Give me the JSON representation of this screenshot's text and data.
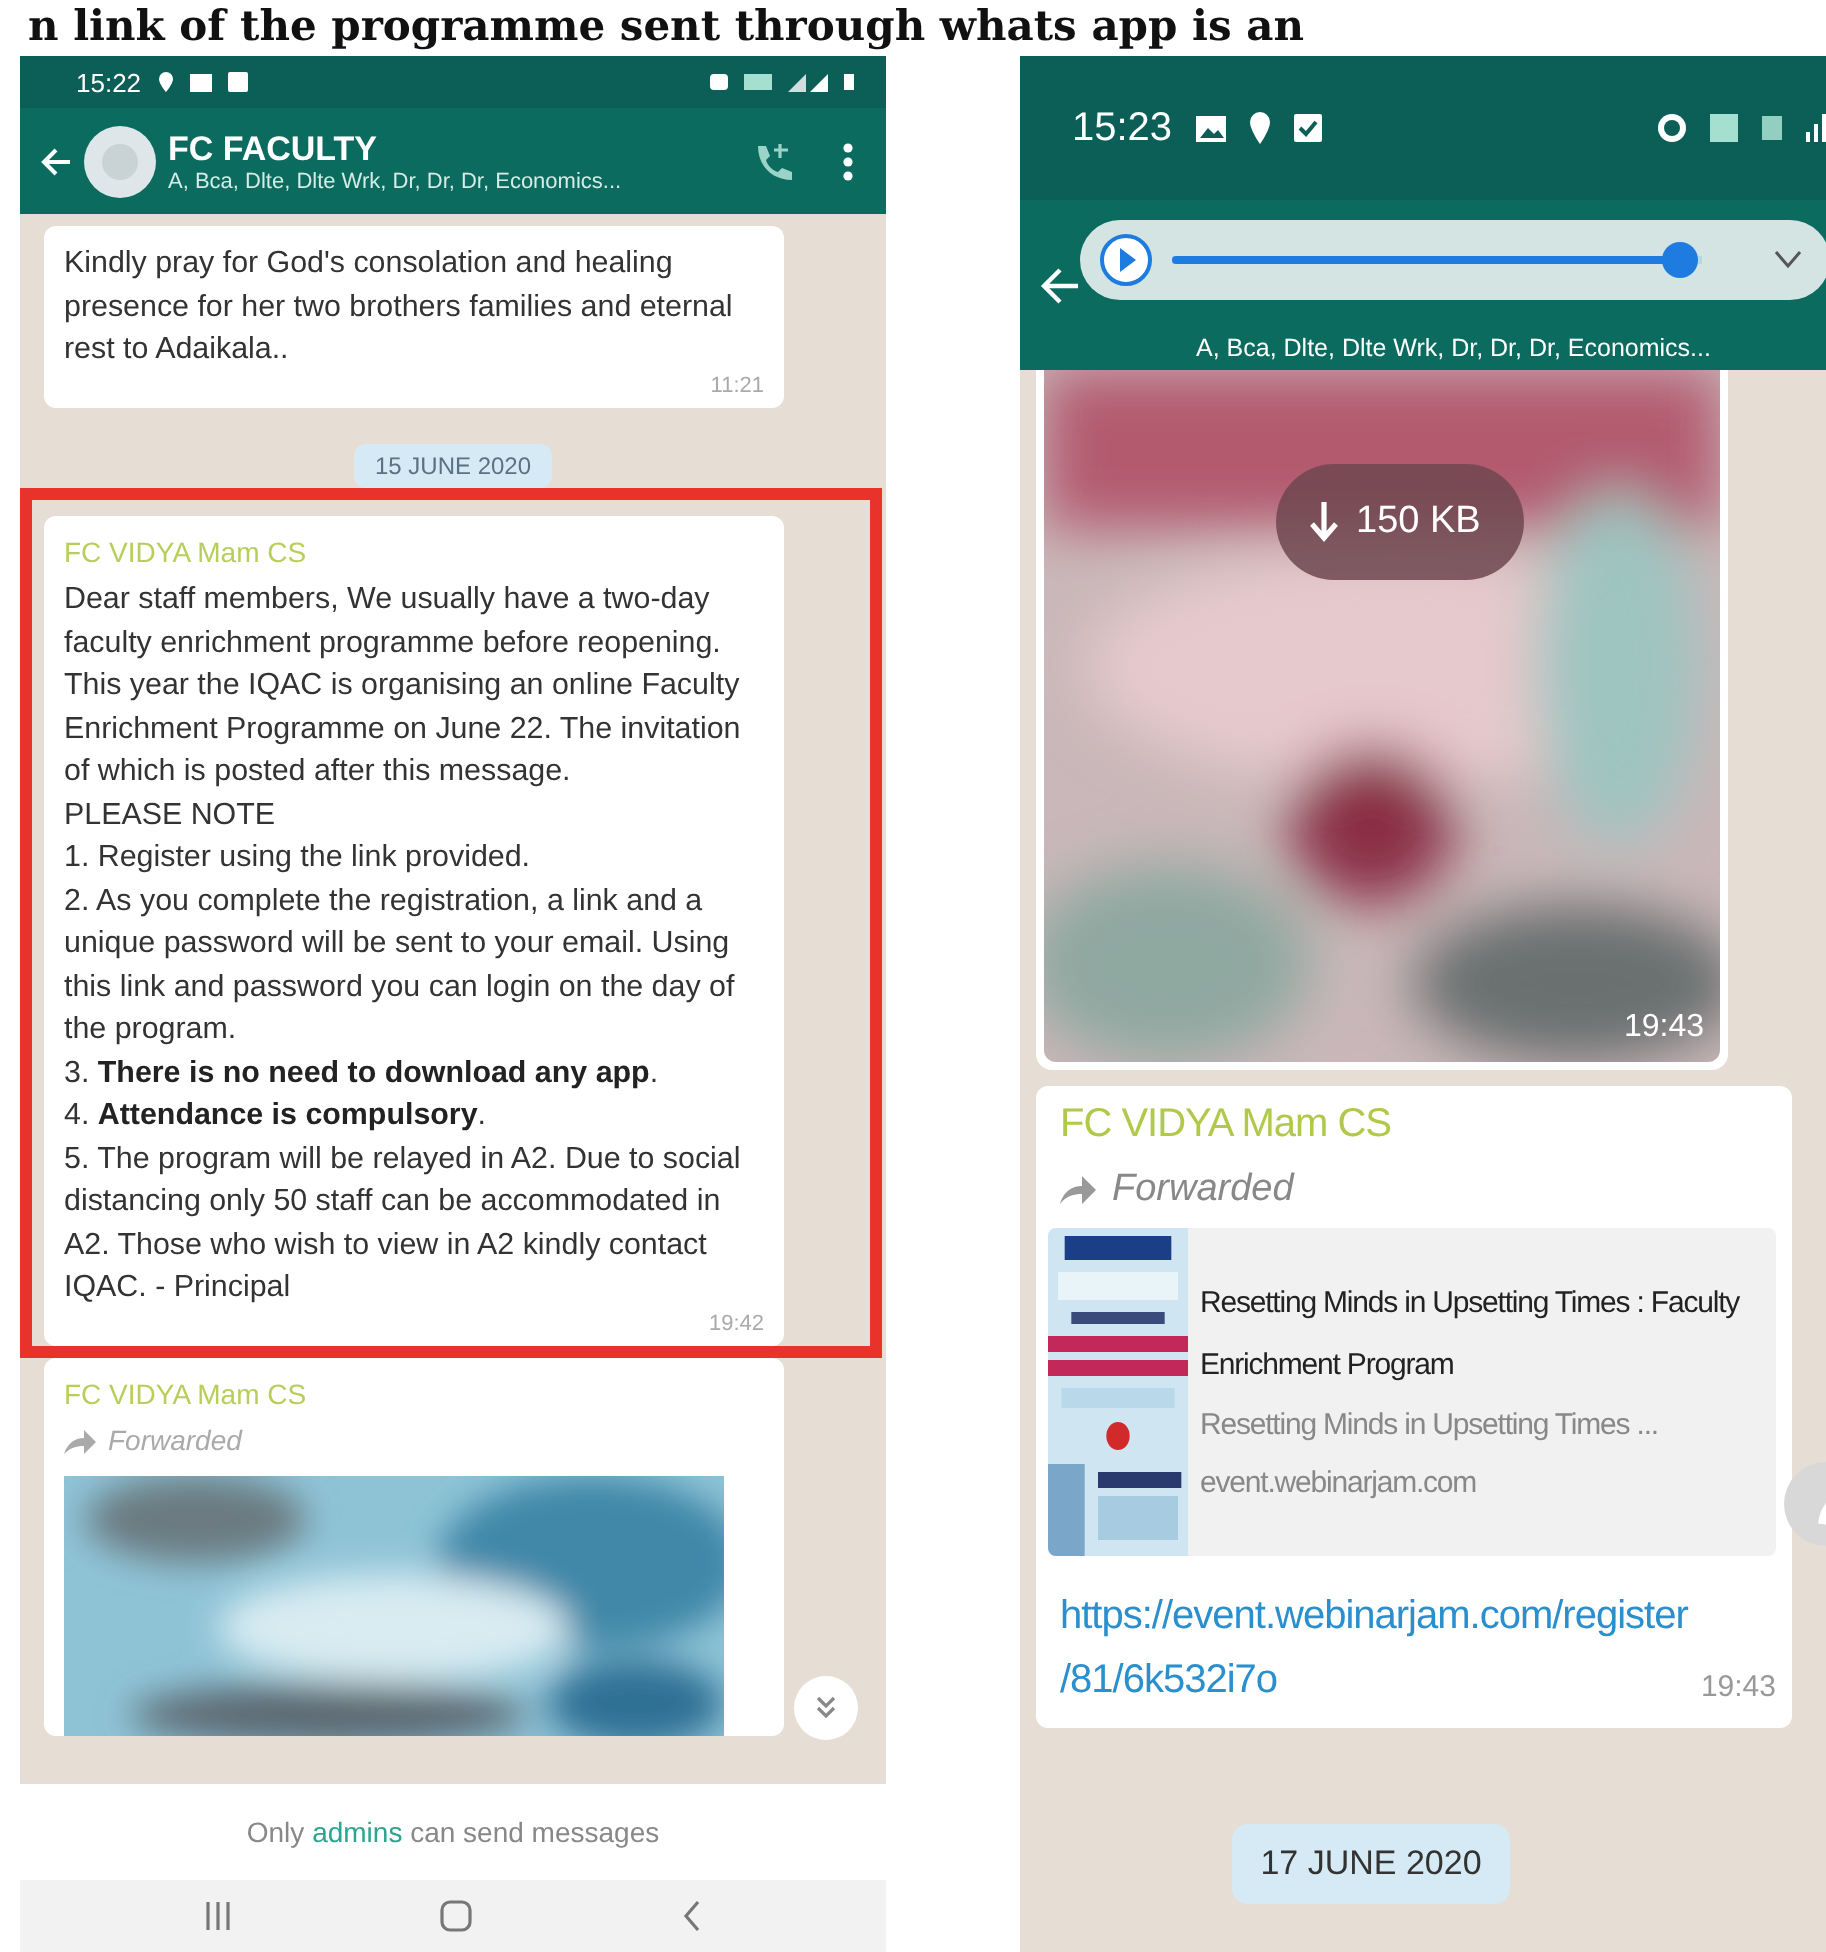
{
  "heading": "n link of the programme sent through whats app is an",
  "left_phone": {
    "status_bar": {
      "time": "15:22"
    },
    "header": {
      "title": "FC FACULTY",
      "subtitle": "A, Bca, Dlte, Dlte Wrk, Dr, Dr, Dr, Economics..."
    },
    "messages": [
      {
        "kind": "text",
        "paragraphs": [
          "Kindly pray for God's consolation and healing presence for her two brothers families and  eternal rest to Adaikala.."
        ],
        "time": "11:21",
        "highlighted": false
      },
      {
        "kind": "date",
        "text": "15 JUNE 2020"
      },
      {
        "kind": "text",
        "sender": "FC VIDYA Mam CS",
        "paragraphs": [
          "Dear staff members, We usually have a two-day faculty enrichment programme before reopening. This year the IQAC is organising an online Faculty Enrichment Programme on June 22. The invitation of which is posted after this message.",
          "PLEASE NOTE",
          "1. Register using the link provided.",
          "2. As you complete the registration, a link and a unique password will be sent to your email. Using this link and password you can login on the day of the program.",
          "3. **There is no need to download any app**.",
          "4. **Attendance is compulsory**.",
          "5. The program will be relayed in A2. Due to social distancing only 50 staff can be accommodated in A2. Those who wish to view in A2 kindly contact IQAC. - Principal"
        ],
        "time": "19:42",
        "highlighted": true
      },
      {
        "kind": "media",
        "sender": "FC VIDYA Mam CS",
        "forwarded_label": "Forwarded"
      }
    ],
    "footer": {
      "before": "Only",
      "link": "admins",
      "after": "can send messages"
    }
  },
  "right_phone": {
    "status_bar": {
      "time": "15:23"
    },
    "header": {
      "subtitle": "A, Bca, Dlte, Dlte Wrk, Dr, Dr, Dr, Economics..."
    },
    "audio_player": {
      "level": 0.96
    },
    "messages": [
      {
        "size": "150 KB",
        "time": "19:43"
      },
      {
        "kind": "link",
        "sender": "FC VIDYA Mam CS",
        "forwarded_label": "Forwarded",
        "preview": {
          "title": "Resetting Minds in Upsetting Times : Faculty Enrichment Program",
          "description": "Resetting Minds in Upsetting Times ...",
          "domain": "event.webinarjam.com"
        },
        "url_lines": [
          "https://event.webinarjam.com/register",
          "/81/6k532i7o"
        ],
        "time": "19:43"
      },
      {
        "kind": "date",
        "text": "17 JUNE 2020"
      }
    ]
  }
}
